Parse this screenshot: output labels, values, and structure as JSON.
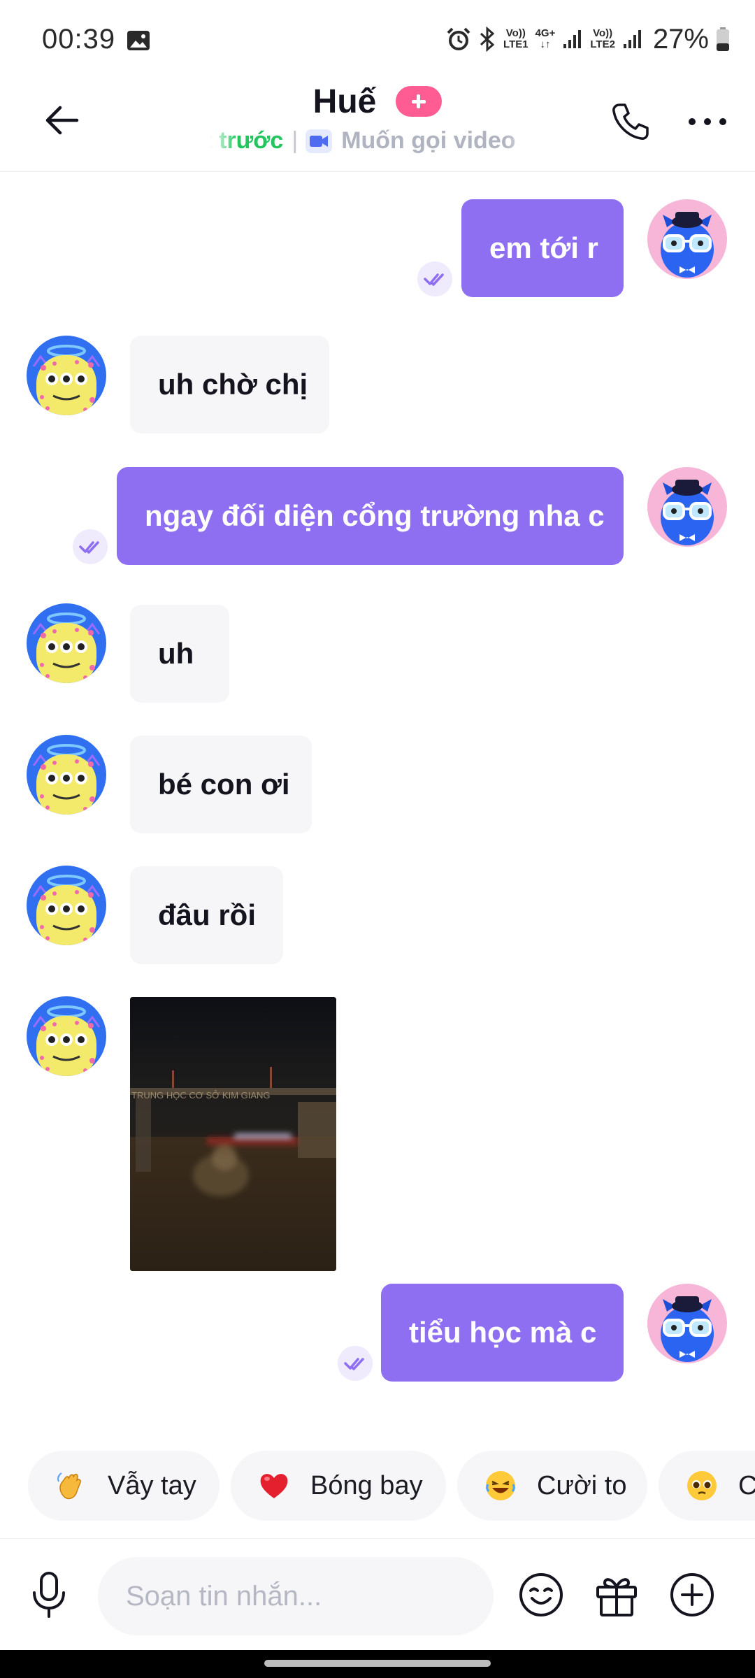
{
  "status_bar": {
    "time": "00:39",
    "network_sim1_top": "Vo))",
    "network_sim1_bottom": "LTE1",
    "network_type": "4G+",
    "network_sim2_top": "Vo))",
    "network_sim2_bottom": "LTE2",
    "battery": "27%",
    "icons": [
      "gallery-icon",
      "alarm-icon",
      "bluetooth-icon",
      "signal-icon",
      "battery-icon"
    ]
  },
  "header": {
    "title": "Huế",
    "subtitle_online": "phút trước",
    "subtitle_separator": "|",
    "subtitle_call": "Muốn gọi video",
    "icons": [
      "back-arrow-icon",
      "add-friend-icon",
      "video-camera-icon",
      "phone-icon",
      "more-dots-icon"
    ]
  },
  "messages": [
    {
      "side": "out",
      "text": "em tới r"
    },
    {
      "side": "in",
      "text": "uh chờ chị"
    },
    {
      "side": "out",
      "text": "ngay đối diện cổng trường nha c"
    },
    {
      "side": "in",
      "text": "uh"
    },
    {
      "side": "in",
      "text": "bé con ơi"
    },
    {
      "side": "in",
      "text": "đâu rồi"
    },
    {
      "side": "in",
      "type": "image",
      "image_text": "TRUNG HỌC CƠ SỞ KIM GIANG"
    },
    {
      "side": "out",
      "text": "tiểu học mà c"
    }
  ],
  "quick_reactions": [
    {
      "emoji": "waving-hand-icon",
      "label": "Vẫy tay"
    },
    {
      "emoji": "red-heart-icon",
      "label": "Bóng bay"
    },
    {
      "emoji": "laughing-face-icon",
      "label": "Cười to"
    },
    {
      "emoji": "pleading-face-icon",
      "label": "C"
    }
  ],
  "composer": {
    "placeholder": "Soạn tin nhắn...",
    "icons": [
      "microphone-icon",
      "emoji-icon",
      "gift-icon",
      "plus-circle-icon"
    ]
  },
  "colors": {
    "outgoing_bubble": "#8f6ff1",
    "incoming_bubble": "#f6f6f9",
    "online_green": "#22c55e",
    "add_badge_pink": "#ff5c93"
  }
}
